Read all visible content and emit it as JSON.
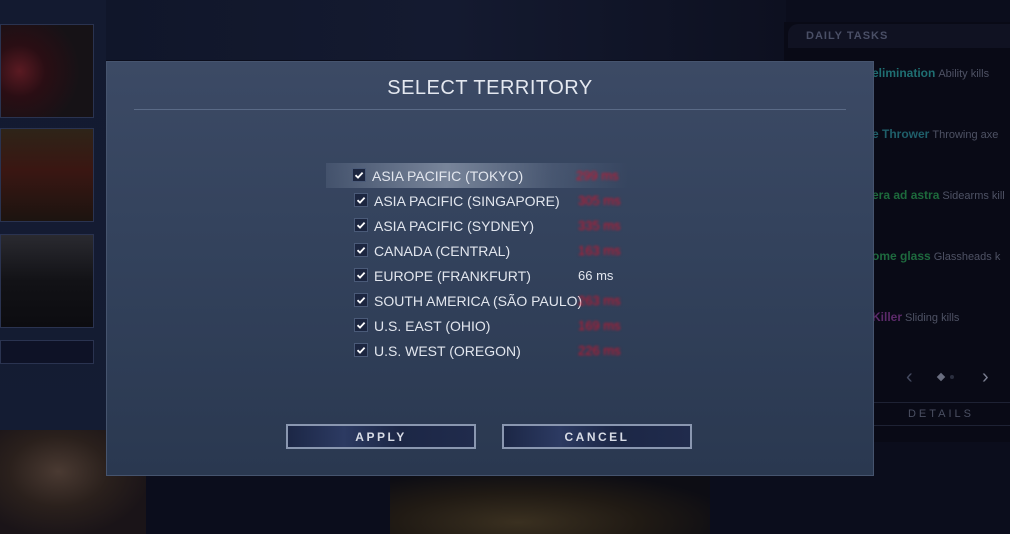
{
  "background": {
    "daily_tasks": {
      "title": "DAILY TASKS",
      "tasks": [
        {
          "name": "elimination",
          "desc": "Ability kills"
        },
        {
          "name": "e Thrower",
          "desc": "Throwing axe"
        },
        {
          "name": "era ad astra",
          "desc": "Sidearms kill"
        },
        {
          "name": "ome glass",
          "desc": "Glassheads k"
        },
        {
          "name": "Killer",
          "desc": "Sliding kills"
        }
      ],
      "pager_prev": "‹",
      "pager_next": "›",
      "details_label": "DETAILS"
    }
  },
  "modal": {
    "title": "SELECT TERRITORY",
    "regions": [
      {
        "name": "ASIA PACIFIC (TOKYO)",
        "ping": "299 ms",
        "checked": true,
        "status": "bad"
      },
      {
        "name": "ASIA PACIFIC (SINGAPORE)",
        "ping": "305 ms",
        "checked": true,
        "status": "bad"
      },
      {
        "name": "ASIA PACIFIC (SYDNEY)",
        "ping": "335 ms",
        "checked": true,
        "status": "bad"
      },
      {
        "name": "CANADA (CENTRAL)",
        "ping": "163 ms",
        "checked": true,
        "status": "bad"
      },
      {
        "name": "EUROPE (FRANKFURT)",
        "ping": "66 ms",
        "checked": true,
        "status": "good"
      },
      {
        "name": "SOUTH AMERICA (SÃO PAULO)",
        "ping": "263 ms",
        "checked": true,
        "status": "bad"
      },
      {
        "name": "U.S. EAST (OHIO)",
        "ping": "169 ms",
        "checked": true,
        "status": "bad"
      },
      {
        "name": "U.S. WEST (OREGON)",
        "ping": "226 ms",
        "checked": true,
        "status": "bad"
      }
    ],
    "apply_label": "APPLY",
    "cancel_label": "CANCEL"
  },
  "colors": {
    "bad_ping": "#d0142c",
    "good_ping": "#e2e6ee",
    "modal_bg": "#33425c"
  }
}
